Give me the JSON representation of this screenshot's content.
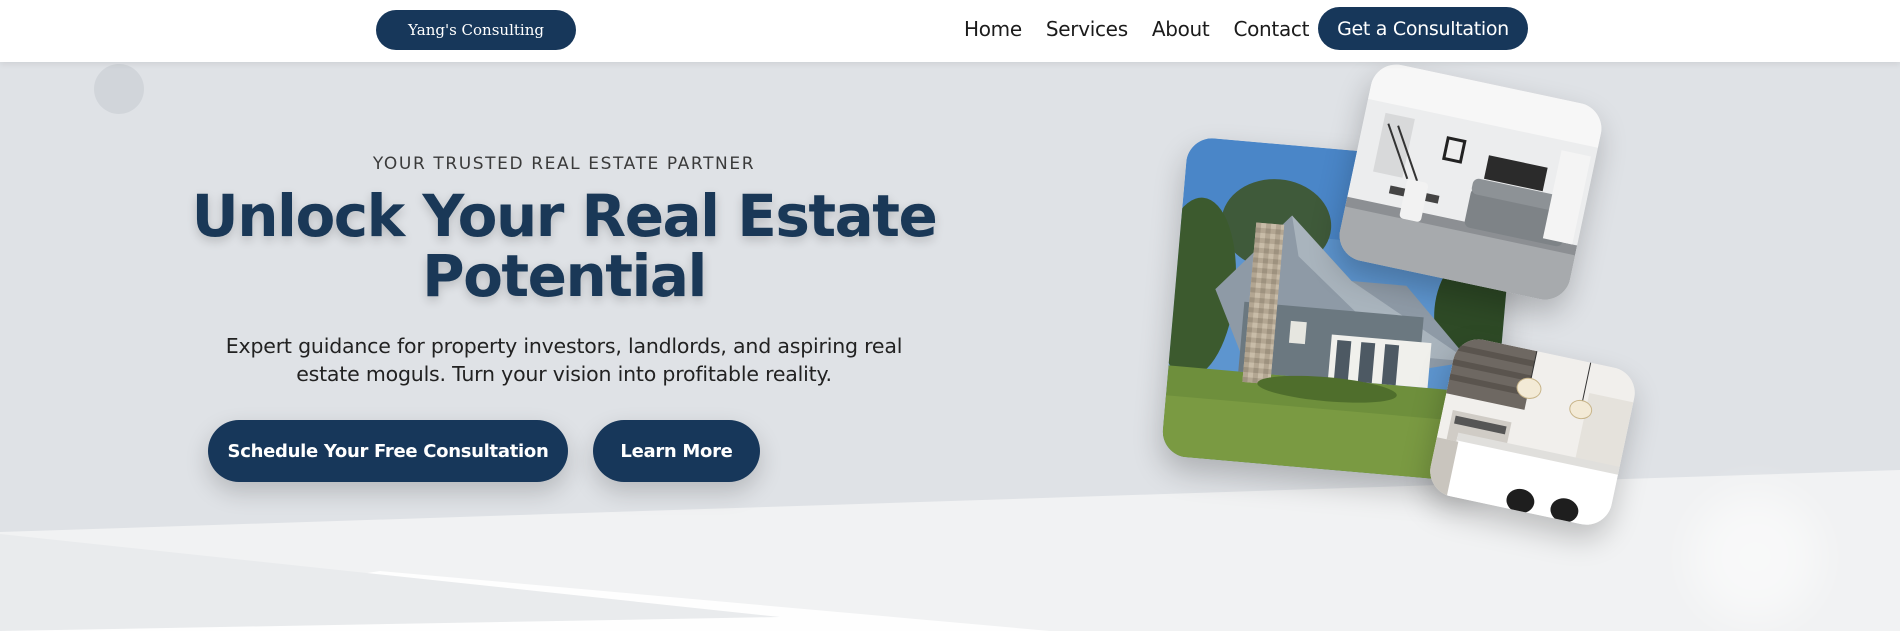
{
  "header": {
    "brand": "Yang's Consulting",
    "nav": [
      "Home",
      "Services",
      "About",
      "Contact"
    ],
    "cta": "Get a Consultation"
  },
  "hero": {
    "eyebrow": "YOUR TRUSTED REAL ESTATE PARTNER",
    "headline": "Unlock Your Real Estate Potential",
    "subtext": "Expert guidance for property investors, landlords, and aspiring real estate moguls. Turn your vision into profitable reality.",
    "primary_button": "Schedule Your Free Consultation",
    "secondary_button": "Learn More"
  },
  "images": [
    "house-exterior-photo",
    "living-room-photo",
    "kitchen-photo"
  ],
  "colors": {
    "brand_navy": "#17375a",
    "hero_background": "#dfe2e6",
    "header_background": "#ffffff"
  }
}
